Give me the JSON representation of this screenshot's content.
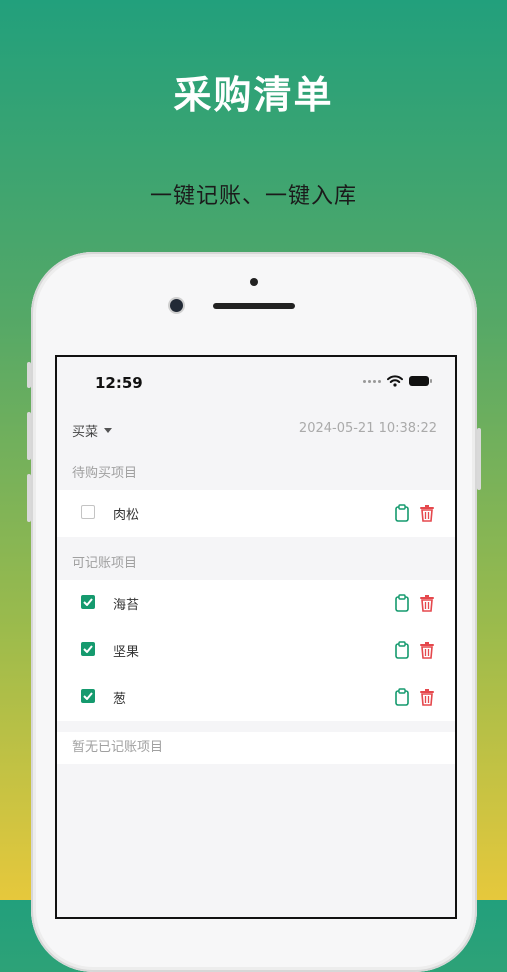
{
  "hero": {
    "title": "采购清单",
    "subtitle": "一键记账、一键入库"
  },
  "status_bar": {
    "time": "12:59"
  },
  "toolbar": {
    "category": "买菜",
    "datetime": "2024-05-21 10:38:22"
  },
  "sections": {
    "pending": {
      "title": "待购买项目",
      "items": [
        {
          "name": "肉松",
          "checked": false
        }
      ]
    },
    "billable": {
      "title": "可记账项目",
      "items": [
        {
          "name": "海苔",
          "checked": true
        },
        {
          "name": "坚果",
          "checked": true
        },
        {
          "name": "葱",
          "checked": true
        }
      ]
    },
    "billed": {
      "empty_text": "暂无已记账项目"
    }
  },
  "icons": {
    "clipboard": "clipboard-icon",
    "trash": "trash-icon",
    "checkbox": "checkbox-icon",
    "wifi": "wifi-icon",
    "battery": "battery-icon"
  },
  "colors": {
    "accent": "#159a6e",
    "danger": "#e5484d",
    "gradient_top": "#22a07c",
    "gradient_bottom": "#e6c83c"
  }
}
